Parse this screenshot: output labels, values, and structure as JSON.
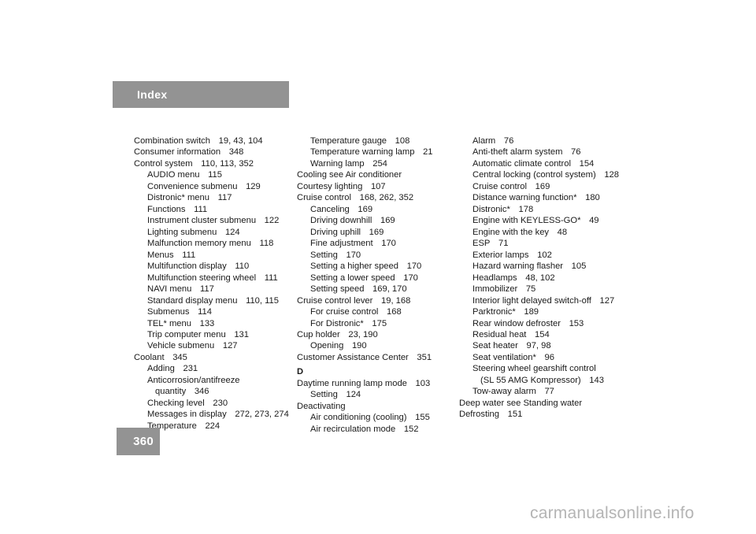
{
  "header": {
    "title": "Index"
  },
  "page": {
    "number": "360"
  },
  "watermark": {
    "text": "carmanualsonline.info"
  },
  "columns": [
    {
      "id": "column-1",
      "entries": [
        {
          "level": 0,
          "term": "Combination switch",
          "pages": "19, 43, 104"
        },
        {
          "level": 0,
          "term": "Consumer information",
          "pages": "348"
        },
        {
          "level": 0,
          "term": "Control system",
          "pages": "110, 113, 352"
        },
        {
          "level": 1,
          "term": "AUDIO menu",
          "pages": "115"
        },
        {
          "level": 1,
          "term": "Convenience submenu",
          "pages": "129"
        },
        {
          "level": 1,
          "term": "Distronic* menu",
          "pages": "117"
        },
        {
          "level": 1,
          "term": "Functions",
          "pages": "111"
        },
        {
          "level": 1,
          "term": "Instrument cluster submenu",
          "pages": "122"
        },
        {
          "level": 1,
          "term": "Lighting submenu",
          "pages": "124"
        },
        {
          "level": 1,
          "term": "Malfunction memory menu",
          "pages": "118"
        },
        {
          "level": 1,
          "term": "Menus",
          "pages": "111"
        },
        {
          "level": 1,
          "term": "Multifunction display",
          "pages": "110"
        },
        {
          "level": 1,
          "term": "Multifunction steering wheel",
          "pages": "111"
        },
        {
          "level": 1,
          "term": "NAVI menu",
          "pages": "117"
        },
        {
          "level": 1,
          "term": "Standard display menu",
          "pages": "110, 115"
        },
        {
          "level": 1,
          "term": "Submenus",
          "pages": "114"
        },
        {
          "level": 1,
          "term": "TEL* menu",
          "pages": "133"
        },
        {
          "level": 1,
          "term": "Trip computer menu",
          "pages": "131"
        },
        {
          "level": 1,
          "term": "Vehicle submenu",
          "pages": "127"
        },
        {
          "level": 0,
          "term": "Coolant",
          "pages": "345"
        },
        {
          "level": 1,
          "term": "Adding",
          "pages": "231"
        },
        {
          "level": 1,
          "term": "Anticorrosion/antifreeze",
          "pages": ""
        },
        {
          "level": 2,
          "term": "quantity",
          "pages": "346"
        },
        {
          "level": 1,
          "term": "Checking level",
          "pages": "230"
        },
        {
          "level": 1,
          "term": "Messages in display",
          "pages": "272, 273, 274"
        },
        {
          "level": 1,
          "term": "Temperature",
          "pages": "224"
        }
      ]
    },
    {
      "id": "column-2",
      "entries": [
        {
          "level": 1,
          "term": "Temperature gauge",
          "pages": "108"
        },
        {
          "level": 1,
          "term": "Temperature warning lamp",
          "pages": "21"
        },
        {
          "level": 1,
          "term": "Warning lamp",
          "pages": "254"
        },
        {
          "level": 0,
          "term": "Cooling see Air conditioner",
          "pages": ""
        },
        {
          "level": 0,
          "term": "Courtesy lighting",
          "pages": "107"
        },
        {
          "level": 0,
          "term": "Cruise control",
          "pages": "168, 262, 352"
        },
        {
          "level": 1,
          "term": "Canceling",
          "pages": "169"
        },
        {
          "level": 1,
          "term": "Driving downhill",
          "pages": "169"
        },
        {
          "level": 1,
          "term": "Driving uphill",
          "pages": "169"
        },
        {
          "level": 1,
          "term": "Fine adjustment",
          "pages": "170"
        },
        {
          "level": 1,
          "term": "Setting",
          "pages": "170"
        },
        {
          "level": 1,
          "term": "Setting a higher speed",
          "pages": "170"
        },
        {
          "level": 1,
          "term": "Setting a lower speed",
          "pages": "170"
        },
        {
          "level": 1,
          "term": "Setting speed",
          "pages": "169, 170"
        },
        {
          "level": 0,
          "term": "Cruise control lever",
          "pages": "19, 168"
        },
        {
          "level": 1,
          "term": "For cruise control",
          "pages": "168"
        },
        {
          "level": 1,
          "term": "For Distronic*",
          "pages": "175"
        },
        {
          "level": 0,
          "term": "Cup holder",
          "pages": "23, 190"
        },
        {
          "level": 1,
          "term": "Opening",
          "pages": "190"
        },
        {
          "level": 0,
          "term": "Customer Assistance Center",
          "pages": "351"
        },
        {
          "letter": "D"
        },
        {
          "level": 0,
          "term": "Daytime running lamp mode",
          "pages": "103"
        },
        {
          "level": 1,
          "term": "Setting",
          "pages": "124"
        },
        {
          "level": 0,
          "term": "Deactivating",
          "pages": ""
        },
        {
          "level": 1,
          "term": "Air conditioning (cooling)",
          "pages": "155"
        },
        {
          "level": 1,
          "term": "Air recirculation mode",
          "pages": "152"
        }
      ]
    },
    {
      "id": "column-3",
      "entries": [
        {
          "level": 1,
          "term": "Alarm",
          "pages": "76"
        },
        {
          "level": 1,
          "term": "Anti-theft alarm system",
          "pages": "76"
        },
        {
          "level": 1,
          "term": "Automatic climate control",
          "pages": "154"
        },
        {
          "level": 1,
          "term": "Central locking (control system)",
          "pages": "128"
        },
        {
          "level": 1,
          "term": "Cruise control",
          "pages": "169"
        },
        {
          "level": 1,
          "term": "Distance warning function*",
          "pages": "180"
        },
        {
          "level": 1,
          "term": "Distronic*",
          "pages": "178"
        },
        {
          "level": 1,
          "term": "Engine with KEYLESS-GO*",
          "pages": "49"
        },
        {
          "level": 1,
          "term": "Engine with the key",
          "pages": "48"
        },
        {
          "level": 1,
          "term": "ESP",
          "pages": "71"
        },
        {
          "level": 1,
          "term": "Exterior lamps",
          "pages": "102"
        },
        {
          "level": 1,
          "term": "Hazard warning flasher",
          "pages": "105"
        },
        {
          "level": 1,
          "term": "Headlamps",
          "pages": "48, 102"
        },
        {
          "level": 1,
          "term": "Immobilizer",
          "pages": "75"
        },
        {
          "level": 1,
          "term": "Interior light delayed switch-off",
          "pages": "127"
        },
        {
          "level": 1,
          "term": "Parktronic*",
          "pages": "189"
        },
        {
          "level": 1,
          "term": "Rear window defroster",
          "pages": "153"
        },
        {
          "level": 1,
          "term": "Residual heat",
          "pages": "154"
        },
        {
          "level": 1,
          "term": "Seat heater",
          "pages": "97, 98"
        },
        {
          "level": 1,
          "term": "Seat ventilation*",
          "pages": "96"
        },
        {
          "level": 1,
          "term": "Steering wheel gearshift control",
          "pages": ""
        },
        {
          "level": 2,
          "term": "(SL 55 AMG Kompressor)",
          "pages": "143"
        },
        {
          "level": 1,
          "term": "Tow-away alarm",
          "pages": "77"
        },
        {
          "level": 0,
          "term": "Deep water see Standing water",
          "pages": ""
        },
        {
          "level": 0,
          "term": "Defrosting",
          "pages": "151"
        }
      ]
    }
  ]
}
